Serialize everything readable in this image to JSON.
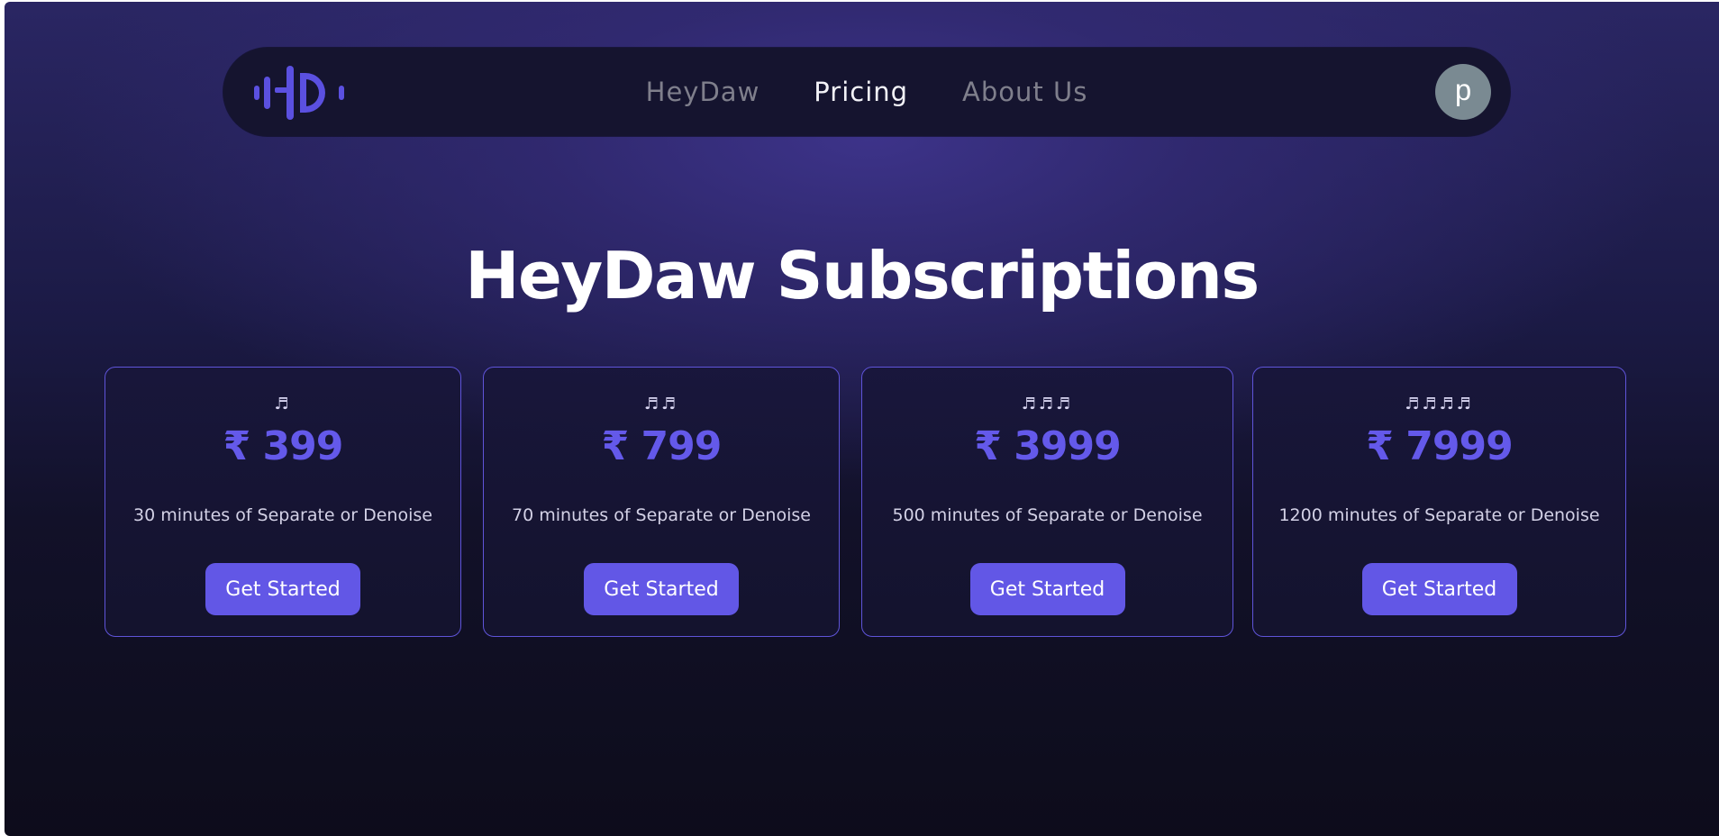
{
  "nav": {
    "logo_icon": "heydaw-waveform-logo-icon",
    "links": [
      {
        "label": "HeyDaw",
        "active": false
      },
      {
        "label": "Pricing",
        "active": true
      },
      {
        "label": "About Us",
        "active": false
      }
    ],
    "avatar_letter": "p"
  },
  "page": {
    "title": "HeyDaw Subscriptions"
  },
  "plans": [
    {
      "notes": "♬",
      "price": "₹ 399",
      "description": "30 minutes of Separate or Denoise",
      "cta": "Get Started"
    },
    {
      "notes": "♬♬",
      "price": "₹ 799",
      "description": "70 minutes of Separate or Denoise",
      "cta": "Get Started"
    },
    {
      "notes": "♬♬♬",
      "price": "₹ 3999",
      "description": "500 minutes of Separate or Denoise",
      "cta": "Get Started"
    },
    {
      "notes": "♬♬♬♬",
      "price": "₹ 7999",
      "description": "1200 minutes of Separate or Denoise",
      "cta": "Get Started"
    }
  ],
  "colors": {
    "accent": "#6257e6",
    "price": "#6459ea",
    "card_border": "#5f54d9",
    "navbar_bg": "#15142f",
    "avatar_bg": "#7a8a92"
  }
}
